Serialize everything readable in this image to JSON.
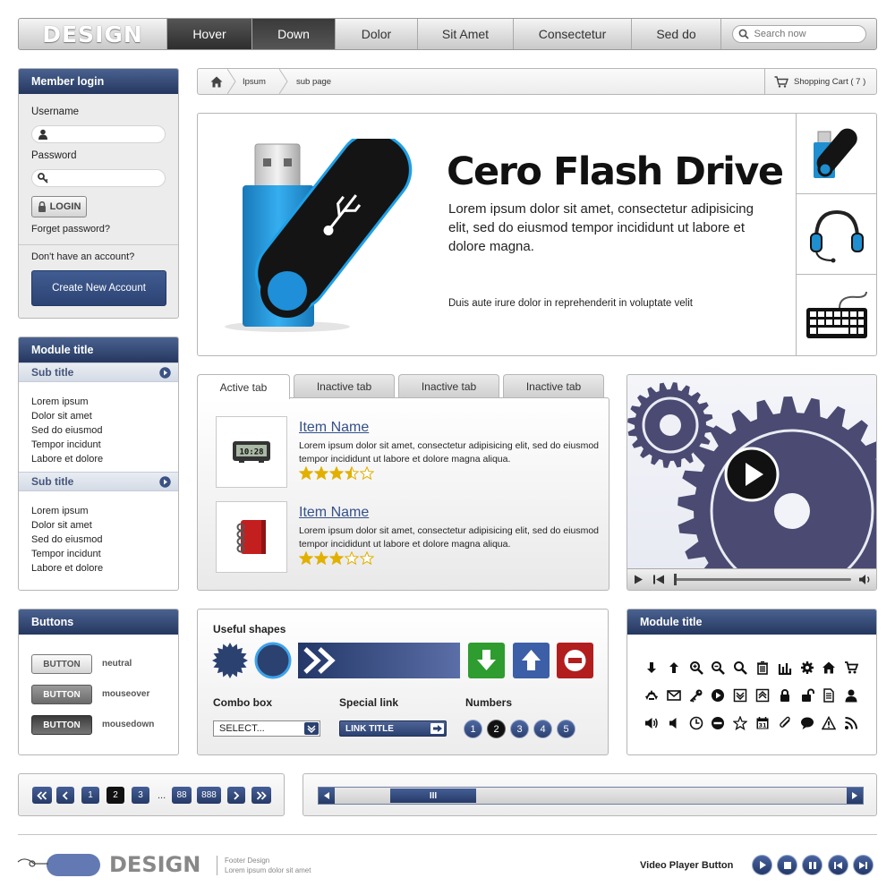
{
  "nav": {
    "logo": "DESIGN",
    "items": [
      "Hover",
      "Down",
      "Dolor",
      "Sit Amet",
      "Consectetur",
      "Sed do"
    ],
    "search_placeholder": "Search now"
  },
  "login": {
    "title": "Member login",
    "username_label": "Username",
    "password_label": "Password",
    "login_button": "LOGIN",
    "forgot": "Forget password?",
    "no_account": "Don't have an account?",
    "create_button": "Create New Account"
  },
  "breadcrumb": {
    "items": [
      "Ipsum",
      "sub page"
    ],
    "cart": "Shopping Cart ( 7 )"
  },
  "hero": {
    "title": "Cero Flash Drive",
    "text": "Lorem ipsum dolor sit amet, consectetur adipisicing elit, sed do eiusmod tempor incididunt ut labore et dolore magna.",
    "small": "Duis aute irure dolor in reprehenderit in voluptate velit",
    "thumbs": [
      "usb-drive-icon",
      "headphones-icon",
      "keyboard-icon"
    ]
  },
  "module_left": {
    "title": "Module title",
    "sections": [
      {
        "subtitle": "Sub title",
        "items": [
          "Lorem ipsum",
          "Dolor sit amet",
          "Sed do eiusmod",
          "Tempor incidunt",
          "Labore et dolore"
        ]
      },
      {
        "subtitle": "Sub title",
        "items": [
          "Lorem ipsum",
          "Dolor sit amet",
          "Sed do eiusmod",
          "Tempor incidunt",
          "Labore et dolore"
        ]
      }
    ]
  },
  "tabs": {
    "labels": [
      "Active tab",
      "Inactive tab",
      "Inactive tab",
      "Inactive tab"
    ],
    "products": [
      {
        "name": "Item Name",
        "desc": "Lorem ipsum dolor sit amet, consectetur adipisicing elit, sed do eiusmod tempor incididunt ut labore et dolore magna aliqua.",
        "rating": 3.5,
        "max": 5,
        "image": "digital-clock-icon"
      },
      {
        "name": "Item Name",
        "desc": "Lorem ipsum dolor sit amet, consectetur adipisicing elit, sed do eiusmod tempor incididunt ut labore et dolore magna aliqua.",
        "rating": 3,
        "max": 5,
        "image": "red-notebook-icon"
      }
    ],
    "clock_display": "10:28"
  },
  "buttons": {
    "title": "Buttons",
    "button_label": "BUTTON",
    "states": [
      "neutral",
      "mouseover",
      "mousedown"
    ]
  },
  "shapes": {
    "title": "Useful shapes",
    "combo_label": "Combo box",
    "combo_value": "SELECT...",
    "special_label": "Special link",
    "special_value": "LINK TITLE",
    "numbers_label": "Numbers",
    "numbers": [
      "1",
      "2",
      "3",
      "4",
      "5"
    ],
    "current_number": "2"
  },
  "module_icons": {
    "title": "Module title",
    "icons": [
      "arrow-down-icon",
      "arrow-up-icon",
      "zoom-in-icon",
      "zoom-out-icon",
      "search-icon",
      "trash-icon",
      "bar-chart-icon",
      "gear-icon",
      "home-icon",
      "cart-icon",
      "recycle-icon",
      "mail-icon",
      "key-icon",
      "play-icon",
      "download-box-icon",
      "upload-box-icon",
      "lock-icon",
      "unlock-icon",
      "document-icon",
      "user-icon",
      "volume-icon",
      "mute-icon",
      "clock-icon",
      "minus-circle-icon",
      "star-icon",
      "calendar-icon",
      "paperclip-icon",
      "chat-icon",
      "warning-icon",
      "rss-icon"
    ],
    "calendar_day": "31"
  },
  "pagination": {
    "pages": [
      "1",
      "2",
      "3",
      "88",
      "888"
    ],
    "current": "2",
    "ellipsis": "..."
  },
  "scrollbar": {
    "thumb_label": "III"
  },
  "footer": {
    "logo": "DESIGN",
    "design_title": "Footer Design",
    "design_sub": "Lorem ipsum dolor sit amet",
    "video_label": "Video Player Button",
    "buttons": [
      "play-icon",
      "stop-icon",
      "pause-icon",
      "prev-icon",
      "next-icon"
    ]
  },
  "colors": {
    "navy": "#2b4170",
    "panel": "#ececec",
    "star": "#e2b000",
    "usb_blue": "#1f8fd0",
    "green": "#2e9c2e",
    "red": "#b21e1e",
    "gear": "#4a4a72"
  }
}
